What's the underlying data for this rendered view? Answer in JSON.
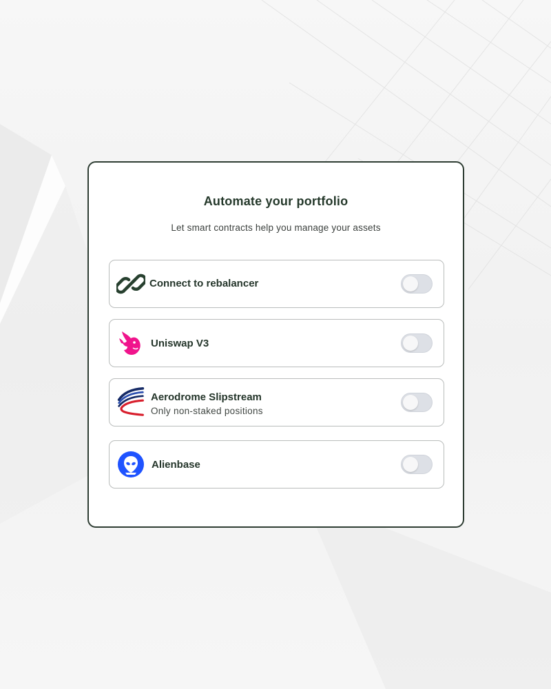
{
  "card": {
    "title": "Automate your portfolio",
    "subtitle": "Let smart contracts help you manage your assets"
  },
  "integrations": [
    {
      "label": "Connect to rebalancer",
      "sublabel": "",
      "icon": "chain-link-icon",
      "toggle_on": false
    },
    {
      "label": "Uniswap V3",
      "sublabel": "",
      "icon": "uniswap-unicorn-icon",
      "toggle_on": false
    },
    {
      "label": "Aerodrome Slipstream",
      "sublabel": "Only non-staked positions",
      "icon": "aerodrome-logo-icon",
      "toggle_on": false
    },
    {
      "label": "Alienbase",
      "sublabel": "",
      "icon": "alienbase-logo-icon",
      "toggle_on": false
    }
  ],
  "colors": {
    "primary_text": "#24382a",
    "card_border": "#2e3d33",
    "uniswap_pink": "#f0148c",
    "alienbase_blue": "#1f53ff",
    "aerodrome_red": "#d81e2c",
    "aerodrome_navy": "#152a66",
    "toggle_off": "#dde0e6"
  }
}
